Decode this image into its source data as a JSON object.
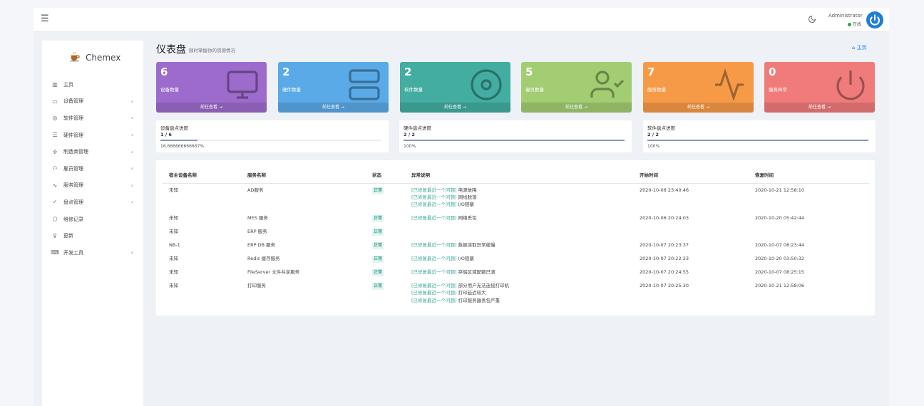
{
  "topbar": {
    "menu_icon": "hamburger-icon",
    "theme_icon": "moon-icon",
    "user_name": "Administrator",
    "user_status": "在线",
    "power_icon": "power-icon"
  },
  "brand": {
    "name": "Chemex",
    "logo_icon": "coffee-icon"
  },
  "sidebar": {
    "items": [
      {
        "label": "主页",
        "icon": "bar-chart-icon",
        "has_children": false
      },
      {
        "label": "设备管理",
        "icon": "monitor-icon",
        "has_children": true
      },
      {
        "label": "软件管理",
        "icon": "disc-icon",
        "has_children": true
      },
      {
        "label": "硬件管理",
        "icon": "server-icon",
        "has_children": true
      },
      {
        "label": "制造商管理",
        "icon": "settings-icon",
        "has_children": true
      },
      {
        "label": "雇员管理",
        "icon": "user-check-icon",
        "has_children": true
      },
      {
        "label": "服务管理",
        "icon": "activity-icon",
        "has_children": true
      },
      {
        "label": "盘点管理",
        "icon": "check-circle-icon",
        "has_children": true
      },
      {
        "label": "维修记录",
        "icon": "shield-icon",
        "has_children": false
      },
      {
        "label": "更新",
        "icon": "filter-icon",
        "has_children": false
      },
      {
        "label": "开发工具",
        "icon": "keyboard-icon",
        "has_children": true
      }
    ]
  },
  "page": {
    "title": "仪表盘",
    "subtitle": "随时掌握你的资源情况",
    "breadcrumb": "主页"
  },
  "cards": [
    {
      "value": "6",
      "label": "设备数量",
      "footer": "前往查看 →",
      "color": "#9c6bcc",
      "icon": "monitor-icon"
    },
    {
      "value": "2",
      "label": "硬件数量",
      "footer": "前往查看 →",
      "color": "#5aaae7",
      "icon": "server-icon"
    },
    {
      "value": "2",
      "label": "软件数量",
      "footer": "前往查看 →",
      "color": "#42ada0",
      "icon": "disc-icon"
    },
    {
      "value": "5",
      "label": "雇员数量",
      "footer": "前往查看 →",
      "color": "#a2cd72",
      "icon": "user-check-icon"
    },
    {
      "value": "7",
      "label": "服务数量",
      "footer": "前往查看 →",
      "color": "#f79a47",
      "icon": "activity-icon"
    },
    {
      "value": "0",
      "label": "服务异常",
      "footer": "前往查看 →",
      "color": "#ef7b7b",
      "icon": "power-icon"
    }
  ],
  "progress": [
    {
      "title": "设备盘点进度",
      "value": "1 / 6",
      "percent_text": "16.666666666667%",
      "fraction": 0.1667
    },
    {
      "title": "硬件盘点进度",
      "value": "2 / 2",
      "percent_text": "100%",
      "fraction": 1.0
    },
    {
      "title": "软件盘点进度",
      "value": "2 / 2",
      "percent_text": "100%",
      "fraction": 1.0
    }
  ],
  "table": {
    "headers": [
      "宿主设备名称",
      "服务名称",
      "状态",
      "异常说明",
      "开始时间",
      "恢复时间"
    ],
    "link_text": "[已修复最近一个问题]",
    "rows": [
      {
        "host": "未知",
        "service": "AD服务",
        "status": "正常",
        "issues": [
          "电源故障",
          "网线脱落",
          "I/O阻塞"
        ],
        "start": "2020-10-06 23:40:46",
        "end": "2020-10-21 12:58:10"
      },
      {
        "host": "未知",
        "service": "MES 服务",
        "status": "正常",
        "issues": [
          "网络丢包"
        ],
        "start": "2020-10-06 20:24:03",
        "end": "2020-10-20 05:42:44"
      },
      {
        "host": "未知",
        "service": "ERP 服务",
        "status": "正常",
        "issues": [],
        "start": "",
        "end": ""
      },
      {
        "host": "NB-1",
        "service": "ERP DB 服务",
        "status": "正常",
        "issues": [
          "数据读取异常缓慢"
        ],
        "start": "2020-10-07 20:23:37",
        "end": "2020-10-07 08:23:44"
      },
      {
        "host": "未知",
        "service": "Redis 缓存服务",
        "status": "正常",
        "issues": [
          "I/O阻塞"
        ],
        "start": "2020-10-07 20:22:23",
        "end": "2020-10-20 03:50:32"
      },
      {
        "host": "未知",
        "service": "FileServer 文件共享服务",
        "status": "正常",
        "issues": [
          "存储区域配额已满"
        ],
        "start": "2020-10-07 20:24:55",
        "end": "2020-10-07 08:25:15"
      },
      {
        "host": "未知",
        "service": "打印服务",
        "status": "正常",
        "issues": [
          "部分用户无法连接打印机",
          "打印延迟较大",
          "打印服务器丢包严重"
        ],
        "start": "2020-10-07 20:25:30",
        "end": "2020-10-21 12:58:06"
      }
    ]
  }
}
